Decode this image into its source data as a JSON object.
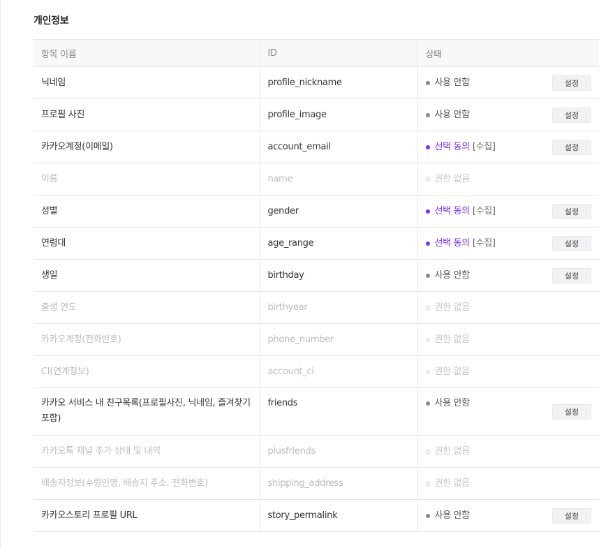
{
  "section": {
    "title": "개인정보"
  },
  "table": {
    "headers": [
      "항목 이름",
      "ID",
      "상태"
    ],
    "rows": [
      {
        "name": "닉네임",
        "id": "profile_nickname",
        "status": "사용 안함",
        "status_type": "unused",
        "button": "설정"
      },
      {
        "name": "프로필 사진",
        "id": "profile_image",
        "status": "사용 안함",
        "status_type": "unused",
        "button": "설정"
      },
      {
        "name": "카카오계정(이메일)",
        "id": "account_email",
        "status": "선택 동의",
        "status_suffix": "[수집]",
        "status_type": "consent",
        "button": "설정"
      },
      {
        "name": "이름",
        "id": "name",
        "status": "권한 없음",
        "status_type": "none"
      },
      {
        "name": "성별",
        "id": "gender",
        "status": "선택 동의",
        "status_suffix": "[수집]",
        "status_type": "consent",
        "button": "설정"
      },
      {
        "name": "연령대",
        "id": "age_range",
        "status": "선택 동의",
        "status_suffix": "[수집]",
        "status_type": "consent",
        "button": "설정"
      },
      {
        "name": "생일",
        "id": "birthday",
        "status": "사용 안함",
        "status_type": "unused",
        "button": "설정"
      },
      {
        "name": "출생 연도",
        "id": "birthyear",
        "status": "권한 없음",
        "status_type": "none"
      },
      {
        "name": "카카오계정(전화번호)",
        "id": "phone_number",
        "status": "권한 없음",
        "status_type": "none"
      },
      {
        "name": "CI(연계정보)",
        "id": "account_ci",
        "status": "권한 없음",
        "status_type": "none"
      },
      {
        "name": "카카오 서비스 내 친구목록(프로필사진, 닉네임, 즐겨찾기 포함)",
        "id": "friends",
        "status": "사용 안함",
        "status_type": "unused",
        "button": "설정",
        "tall": true
      },
      {
        "name": "카카오톡 채널 추가 상태 및 내역",
        "id": "plusfriends",
        "status": "권한 없음",
        "status_type": "none"
      },
      {
        "name": "배송지정보(수령인명, 배송지 주소, 전화번호)",
        "id": "shipping_address",
        "status": "권한 없음",
        "status_type": "none"
      },
      {
        "name": "카카오스토리 프로필 URL",
        "id": "story_permalink",
        "status": "사용 안함",
        "status_type": "unused",
        "button": "설정"
      }
    ]
  },
  "colors": {
    "consent": "#7b2ff2",
    "unused_dot": "#888888",
    "disabled_text": "#bbbbbb",
    "header_bg": "#f8f8f8"
  }
}
